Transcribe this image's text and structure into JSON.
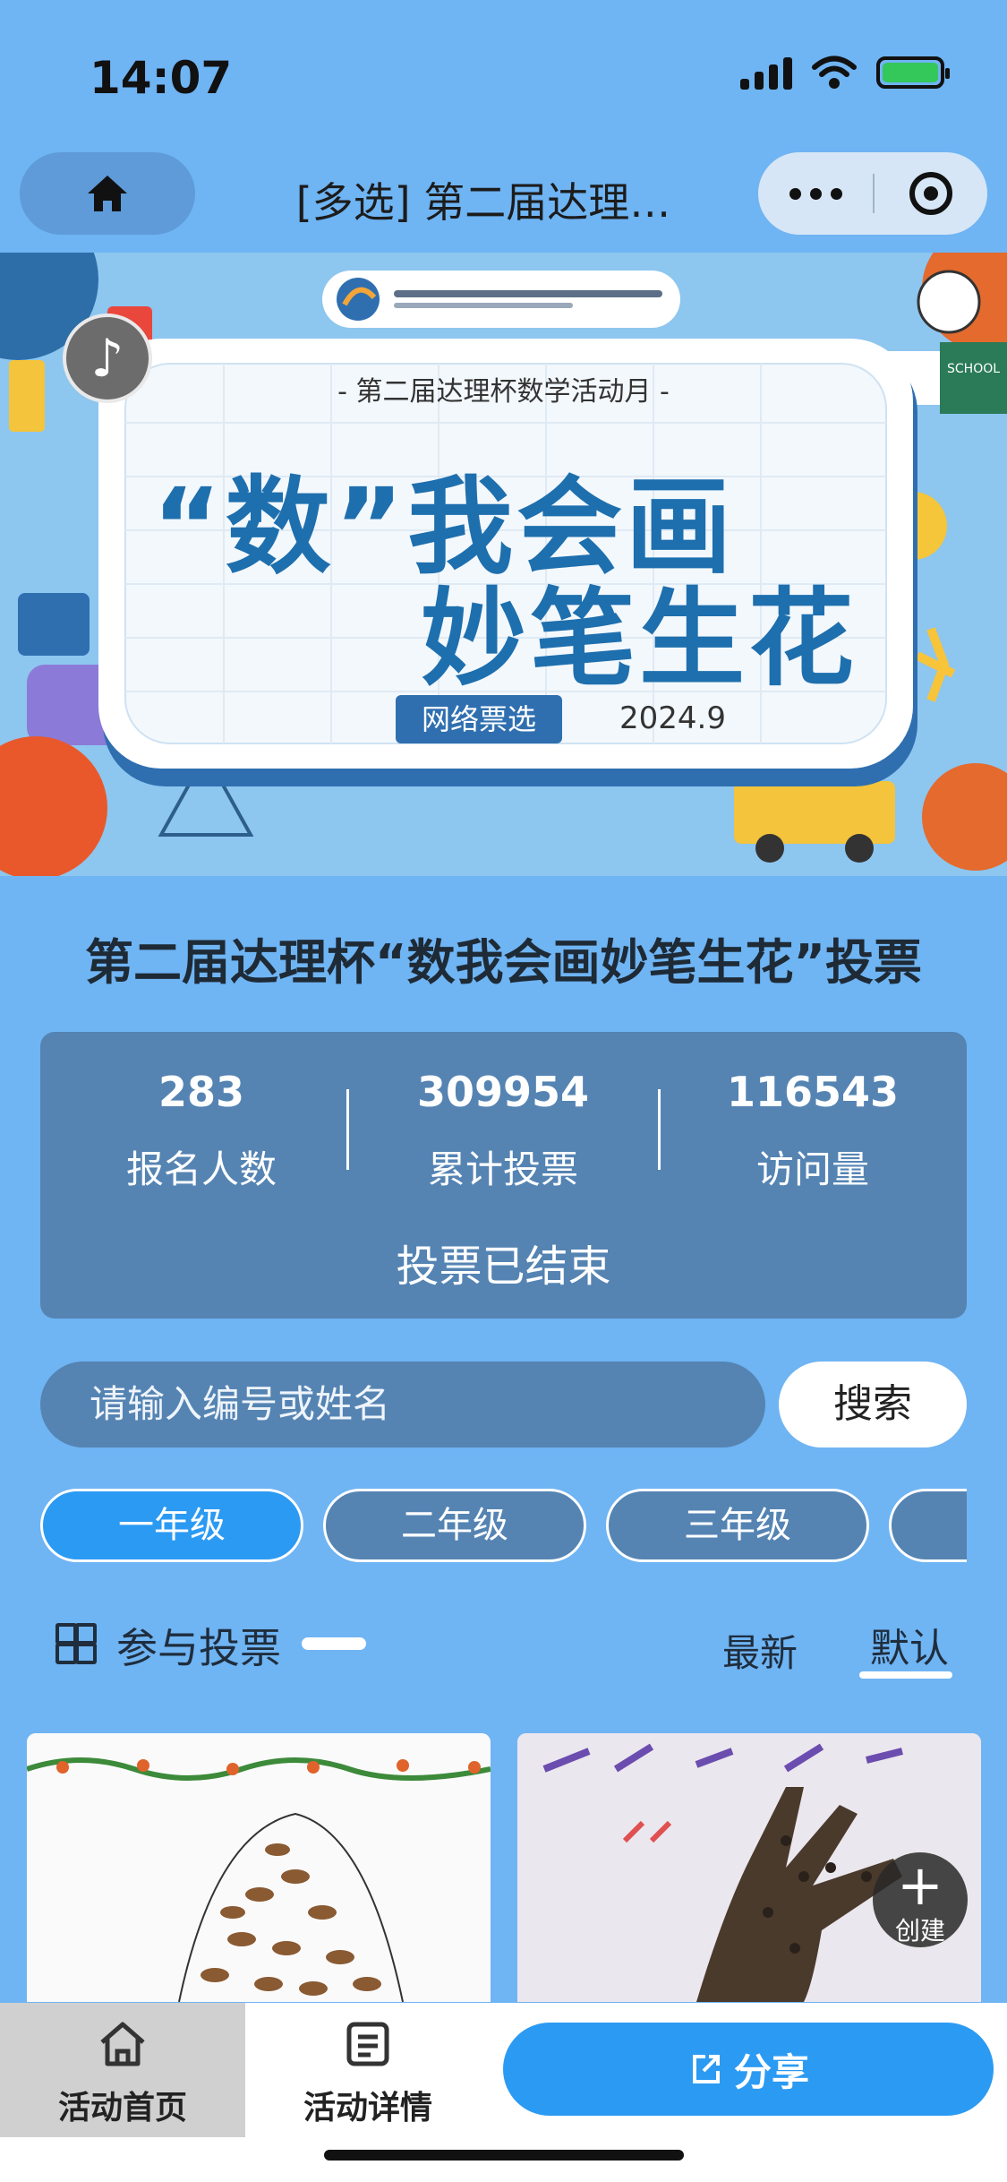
{
  "status_bar": {
    "time": "14:07"
  },
  "nav": {
    "title": "[多选] 第二届达理…"
  },
  "banner": {
    "subtitle": "- 第二届达理杯数学活动月 -",
    "headline_line1": "“数”我会画",
    "headline_line2": "妙笔生花",
    "tag": "网络票选",
    "date": "2024.9",
    "school_sign": "SCHOOL"
  },
  "activity": {
    "title": "第二届达理杯“数我会画妙笔生花”投票"
  },
  "stats": {
    "registrants": {
      "value": "283",
      "label": "报名人数"
    },
    "total_votes": {
      "value": "309954",
      "label": "累计投票"
    },
    "visits": {
      "value": "116543",
      "label": "访问量"
    },
    "status": "投票已结束"
  },
  "search": {
    "placeholder": "请输入编号或姓名",
    "button_label": "搜索"
  },
  "grade_tabs": [
    {
      "label": "一年级",
      "active": true
    },
    {
      "label": "二年级",
      "active": false
    },
    {
      "label": "三年级",
      "active": false
    },
    {
      "label": "",
      "active": false
    }
  ],
  "section": {
    "title": "参与投票",
    "sort_latest": "最新",
    "sort_default": "默认"
  },
  "fab": {
    "label": "创建"
  },
  "bottom_bar": {
    "home_label": "活动首页",
    "detail_label": "活动详情",
    "share_label": "分享"
  },
  "colors": {
    "accent": "#2b9af3",
    "panel": "#5584b3",
    "background": "#6fb4f3"
  }
}
